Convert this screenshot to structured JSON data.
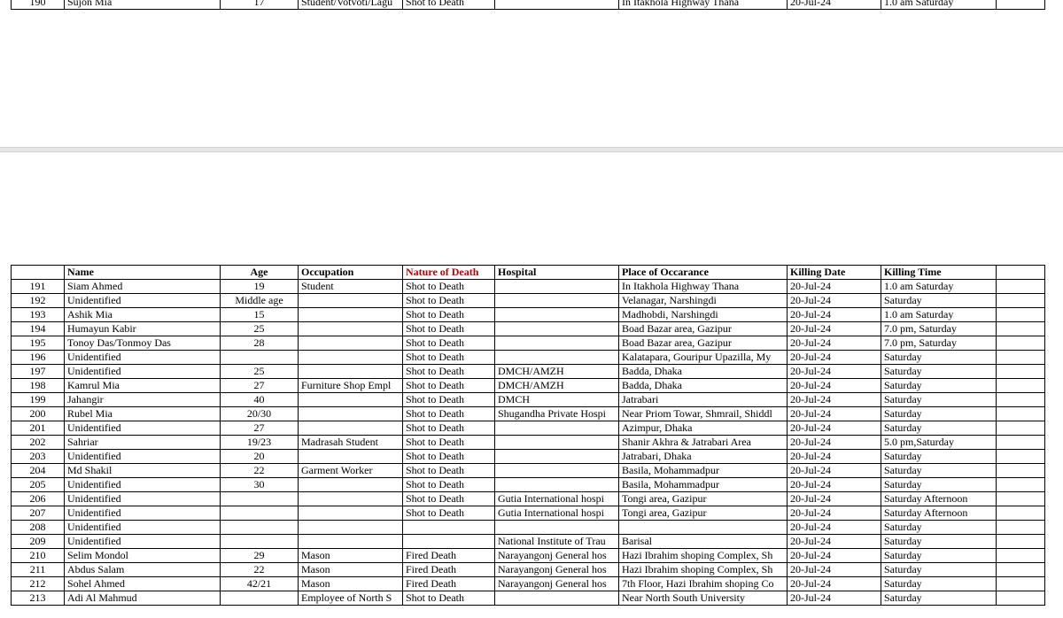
{
  "top_row": {
    "no": "190",
    "name": "Sujon Mia",
    "age": "17",
    "occupation": "Student/Votvoti/Lagu",
    "nature": "Shot to Death",
    "hospital": "",
    "place": "In Itakhola Highway Thana",
    "date": "20-Jul-24",
    "time": "1.0 am Saturday"
  },
  "headers": {
    "no": "",
    "name": "Name",
    "age": "Age",
    "occupation": "Occupation",
    "nature": "Nature of Death",
    "hospital": "Hospital",
    "place": "Place of Occarance",
    "date": "Killing Date",
    "time": "Killing  Time"
  },
  "rows": [
    {
      "no": "191",
      "name": "Siam Ahmed",
      "age": "19",
      "occupation": "Student",
      "nature": "Shot to Death",
      "hospital": "",
      "place": "In Itakhola Highway Thana",
      "date": "20-Jul-24",
      "time": "1.0 am Saturday"
    },
    {
      "no": "192",
      "name": "Unidentified",
      "age": "Middle age",
      "occupation": "",
      "nature": "Shot to Death",
      "hospital": "",
      "place": "Velanagar, Narshingdi",
      "date": "20-Jul-24",
      "time": "Saturday"
    },
    {
      "no": "193",
      "name": "Ashik Mia",
      "age": "15",
      "occupation": "",
      "nature": "Shot to Death",
      "hospital": "",
      "place": "Madhobdi,  Narshingdi",
      "date": "20-Jul-24",
      "time": "1.0 am Saturday"
    },
    {
      "no": "194",
      "name": "Humayun Kabir",
      "age": "25",
      "occupation": "",
      "nature": "Shot to Death",
      "hospital": "",
      "place": "Boad Bazar area, Gazipur",
      "date": "20-Jul-24",
      "time": "7.0 pm, Saturday"
    },
    {
      "no": "195",
      "name": "Tonoy Das/Tonmoy Das",
      "age": "28",
      "occupation": "",
      "nature": "Shot to Death",
      "hospital": "",
      "place": "Boad Bazar area, Gazipur",
      "date": "20-Jul-24",
      "time": "7.0 pm, Saturday"
    },
    {
      "no": "196",
      "name": "Unidentified",
      "age": "",
      "occupation": "",
      "nature": "Shot to Death",
      "hospital": "",
      "place": "Kalatapara, Gouripur Upazilla, My",
      "date": "20-Jul-24",
      "time": "Saturday"
    },
    {
      "no": "197",
      "name": "Unidentified",
      "age": "25",
      "occupation": "",
      "nature": "Shot to Death",
      "hospital": "DMCH/AMZH",
      "place": "Badda, Dhaka",
      "date": "20-Jul-24",
      "time": "Saturday"
    },
    {
      "no": "198",
      "name": "Kamrul Mia",
      "age": "27",
      "occupation": "Furniture Shop Empl",
      "nature": "Shot to Death",
      "hospital": "DMCH/AMZH",
      "place": "Badda, Dhaka",
      "date": "20-Jul-24",
      "time": "Saturday"
    },
    {
      "no": "199",
      "name": "Jahangir",
      "age": "40",
      "occupation": "",
      "nature": "Shot to Death",
      "hospital": "DMCH",
      "place": "Jatrabari",
      "date": "20-Jul-24",
      "time": "Saturday"
    },
    {
      "no": "200",
      "name": "Rubel Mia",
      "age": "20/30",
      "occupation": "",
      "nature": "Shot to Death",
      "hospital": "Shugandha Private Hospi",
      "place": "Near Priom Towar, Shmrail, Shiddl",
      "date": "20-Jul-24",
      "time": "Saturday"
    },
    {
      "no": "201",
      "name": "Unidentified",
      "age": "27",
      "occupation": "",
      "nature": "Shot to Death",
      "hospital": "",
      "place": "Azimpur, Dhaka",
      "date": "20-Jul-24",
      "time": "Saturday"
    },
    {
      "no": "202",
      "name": "Sahriar",
      "age": "19/23",
      "occupation": "Madrasah Student",
      "nature": "Shot to Death",
      "hospital": "",
      "place": "Shanir Akhra & Jatrabari Area",
      "date": "20-Jul-24",
      "time": "5.0 pm,Saturday"
    },
    {
      "no": "203",
      "name": "Unidentified",
      "age": "20",
      "occupation": "",
      "nature": "Shot to Death",
      "hospital": "",
      "place": "Jatrabari, Dhaka",
      "date": "20-Jul-24",
      "time": "Saturday"
    },
    {
      "no": "204",
      "name": "Md Shakil",
      "age": "22",
      "occupation": "Garment Worker",
      "nature": "Shot to Death",
      "hospital": "",
      "place": "Basila, Mohammadpur",
      "date": "20-Jul-24",
      "time": "Saturday"
    },
    {
      "no": "205",
      "name": "Unidentified",
      "age": "30",
      "occupation": "",
      "nature": "Shot to Death",
      "hospital": "",
      "place": "Basila, Mohammadpur",
      "date": "20-Jul-24",
      "time": "Saturday"
    },
    {
      "no": "206",
      "name": "Unidentified",
      "age": "",
      "occupation": "",
      "nature": "Shot to Death",
      "hospital": "Gutia International hospi",
      "place": "Tongi area, Gazipur",
      "date": "20-Jul-24",
      "time": " Saturday Afternoon"
    },
    {
      "no": "207",
      "name": "Unidentified",
      "age": "",
      "occupation": "",
      "nature": "Shot to Death",
      "hospital": "Gutia International hospi",
      "place": "Tongi area, Gazipur",
      "date": "20-Jul-24",
      "time": " Saturday Afternoon"
    },
    {
      "no": "208",
      "name": "Unidentified",
      "age": "",
      "occupation": "",
      "nature": "",
      "hospital": "",
      "place": "",
      "date": "20-Jul-24",
      "time": "Saturday"
    },
    {
      "no": "209",
      "name": "Unidentified",
      "age": "",
      "occupation": "",
      "nature": "",
      "hospital": "National Institute of Trau",
      "place": "Barisal",
      "date": "20-Jul-24",
      "time": "Saturday"
    },
    {
      "no": "210",
      "name": "Selim Mondol",
      "age": "29",
      "occupation": "Mason",
      "nature": "Fired Death",
      "hospital": "Narayangonj General hos",
      "place": "Hazi Ibrahim shoping Complex, Sh",
      "date": "20-Jul-24",
      "time": "Saturday"
    },
    {
      "no": "211",
      "name": "Abdus Salam",
      "age": "22",
      "occupation": "Mason",
      "nature": "Fired Death",
      "hospital": "Narayangonj General hos",
      "place": "Hazi Ibrahim shoping Complex, Sh",
      "date": "20-Jul-24",
      "time": "Saturday"
    },
    {
      "no": "212",
      "name": "Sohel Ahmed",
      "age": "42/21",
      "occupation": "Mason",
      "nature": "Fired Death",
      "hospital": "Narayangonj General hos",
      "place": "7th Floor, Hazi Ibrahim shoping Co",
      "date": "20-Jul-24",
      "time": "Saturday"
    },
    {
      "no": "213",
      "name": "Adi Al Mahmud",
      "age": "",
      "occupation": "Employee of North S",
      "nature": "Shot to Death",
      "hospital": "",
      "place": "Near North South University",
      "date": "20-Jul-24",
      "time": "Saturday"
    }
  ],
  "colors": {
    "nature_header": "#c00000"
  }
}
